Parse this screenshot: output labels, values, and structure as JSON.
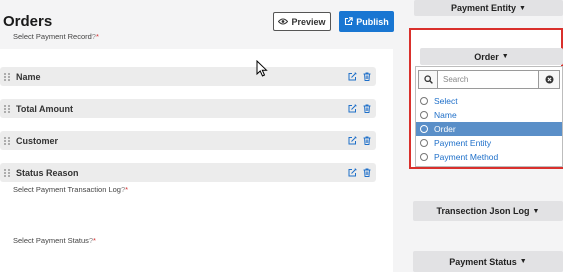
{
  "header": {
    "title": "Orders",
    "preview_label": "Preview",
    "publish_label": "Publish"
  },
  "fields": [
    {
      "label": "Name"
    },
    {
      "label": "Total Amount"
    },
    {
      "label": "Customer"
    },
    {
      "label": "Status Reason"
    }
  ],
  "right_panel": {
    "top_button": "Payment Entity",
    "payment_record": {
      "label": "Select Payment Record",
      "selected": "Order",
      "search_placeholder": "Search",
      "options": [
        "Select",
        "Name",
        "Order",
        "Payment Entity",
        "Payment Method"
      ],
      "selected_index": 2
    },
    "transaction_log": {
      "label": "Select Payment Transaction Log",
      "selected": "Transection Json Log"
    },
    "payment_status": {
      "label": "Select Payment Status",
      "selected": "Payment Status"
    },
    "help_mark": "?",
    "required_mark": "*"
  },
  "colors": {
    "accent": "#1976d2",
    "highlight": "#5a8fc8",
    "required": "#d32f2f",
    "outline": "#d9302c"
  }
}
